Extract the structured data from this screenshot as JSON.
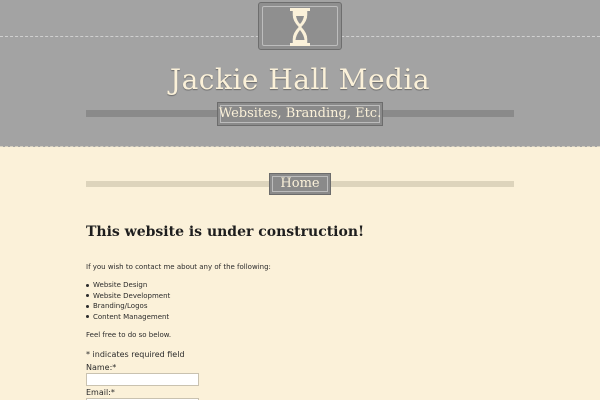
{
  "header": {
    "logo_icon": "hourglass-icon",
    "title": "Jackie Hall Media",
    "tagline": "Websites, Branding, Etc.",
    "colors": {
      "header_bg": "#a3a3a3",
      "box_bg": "#8a8a8a",
      "title_text": "#fbf1d9"
    }
  },
  "nav": {
    "items": [
      {
        "label": "Home"
      }
    ]
  },
  "content": {
    "heading": "This website is under construction!",
    "intro": "If you wish to contact me about any of the following:",
    "services": [
      "Website Design",
      "Website Development",
      "Branding/Logos",
      "Content Management"
    ],
    "closing": "Feel free to do so below.",
    "form": {
      "required_note": "* indicates required field",
      "name_label": "Name:*",
      "name_value": "",
      "email_label": "Email:*",
      "email_value": ""
    },
    "colors": {
      "page_bg": "#fbf1d9",
      "text": "#2b2b2b"
    }
  }
}
